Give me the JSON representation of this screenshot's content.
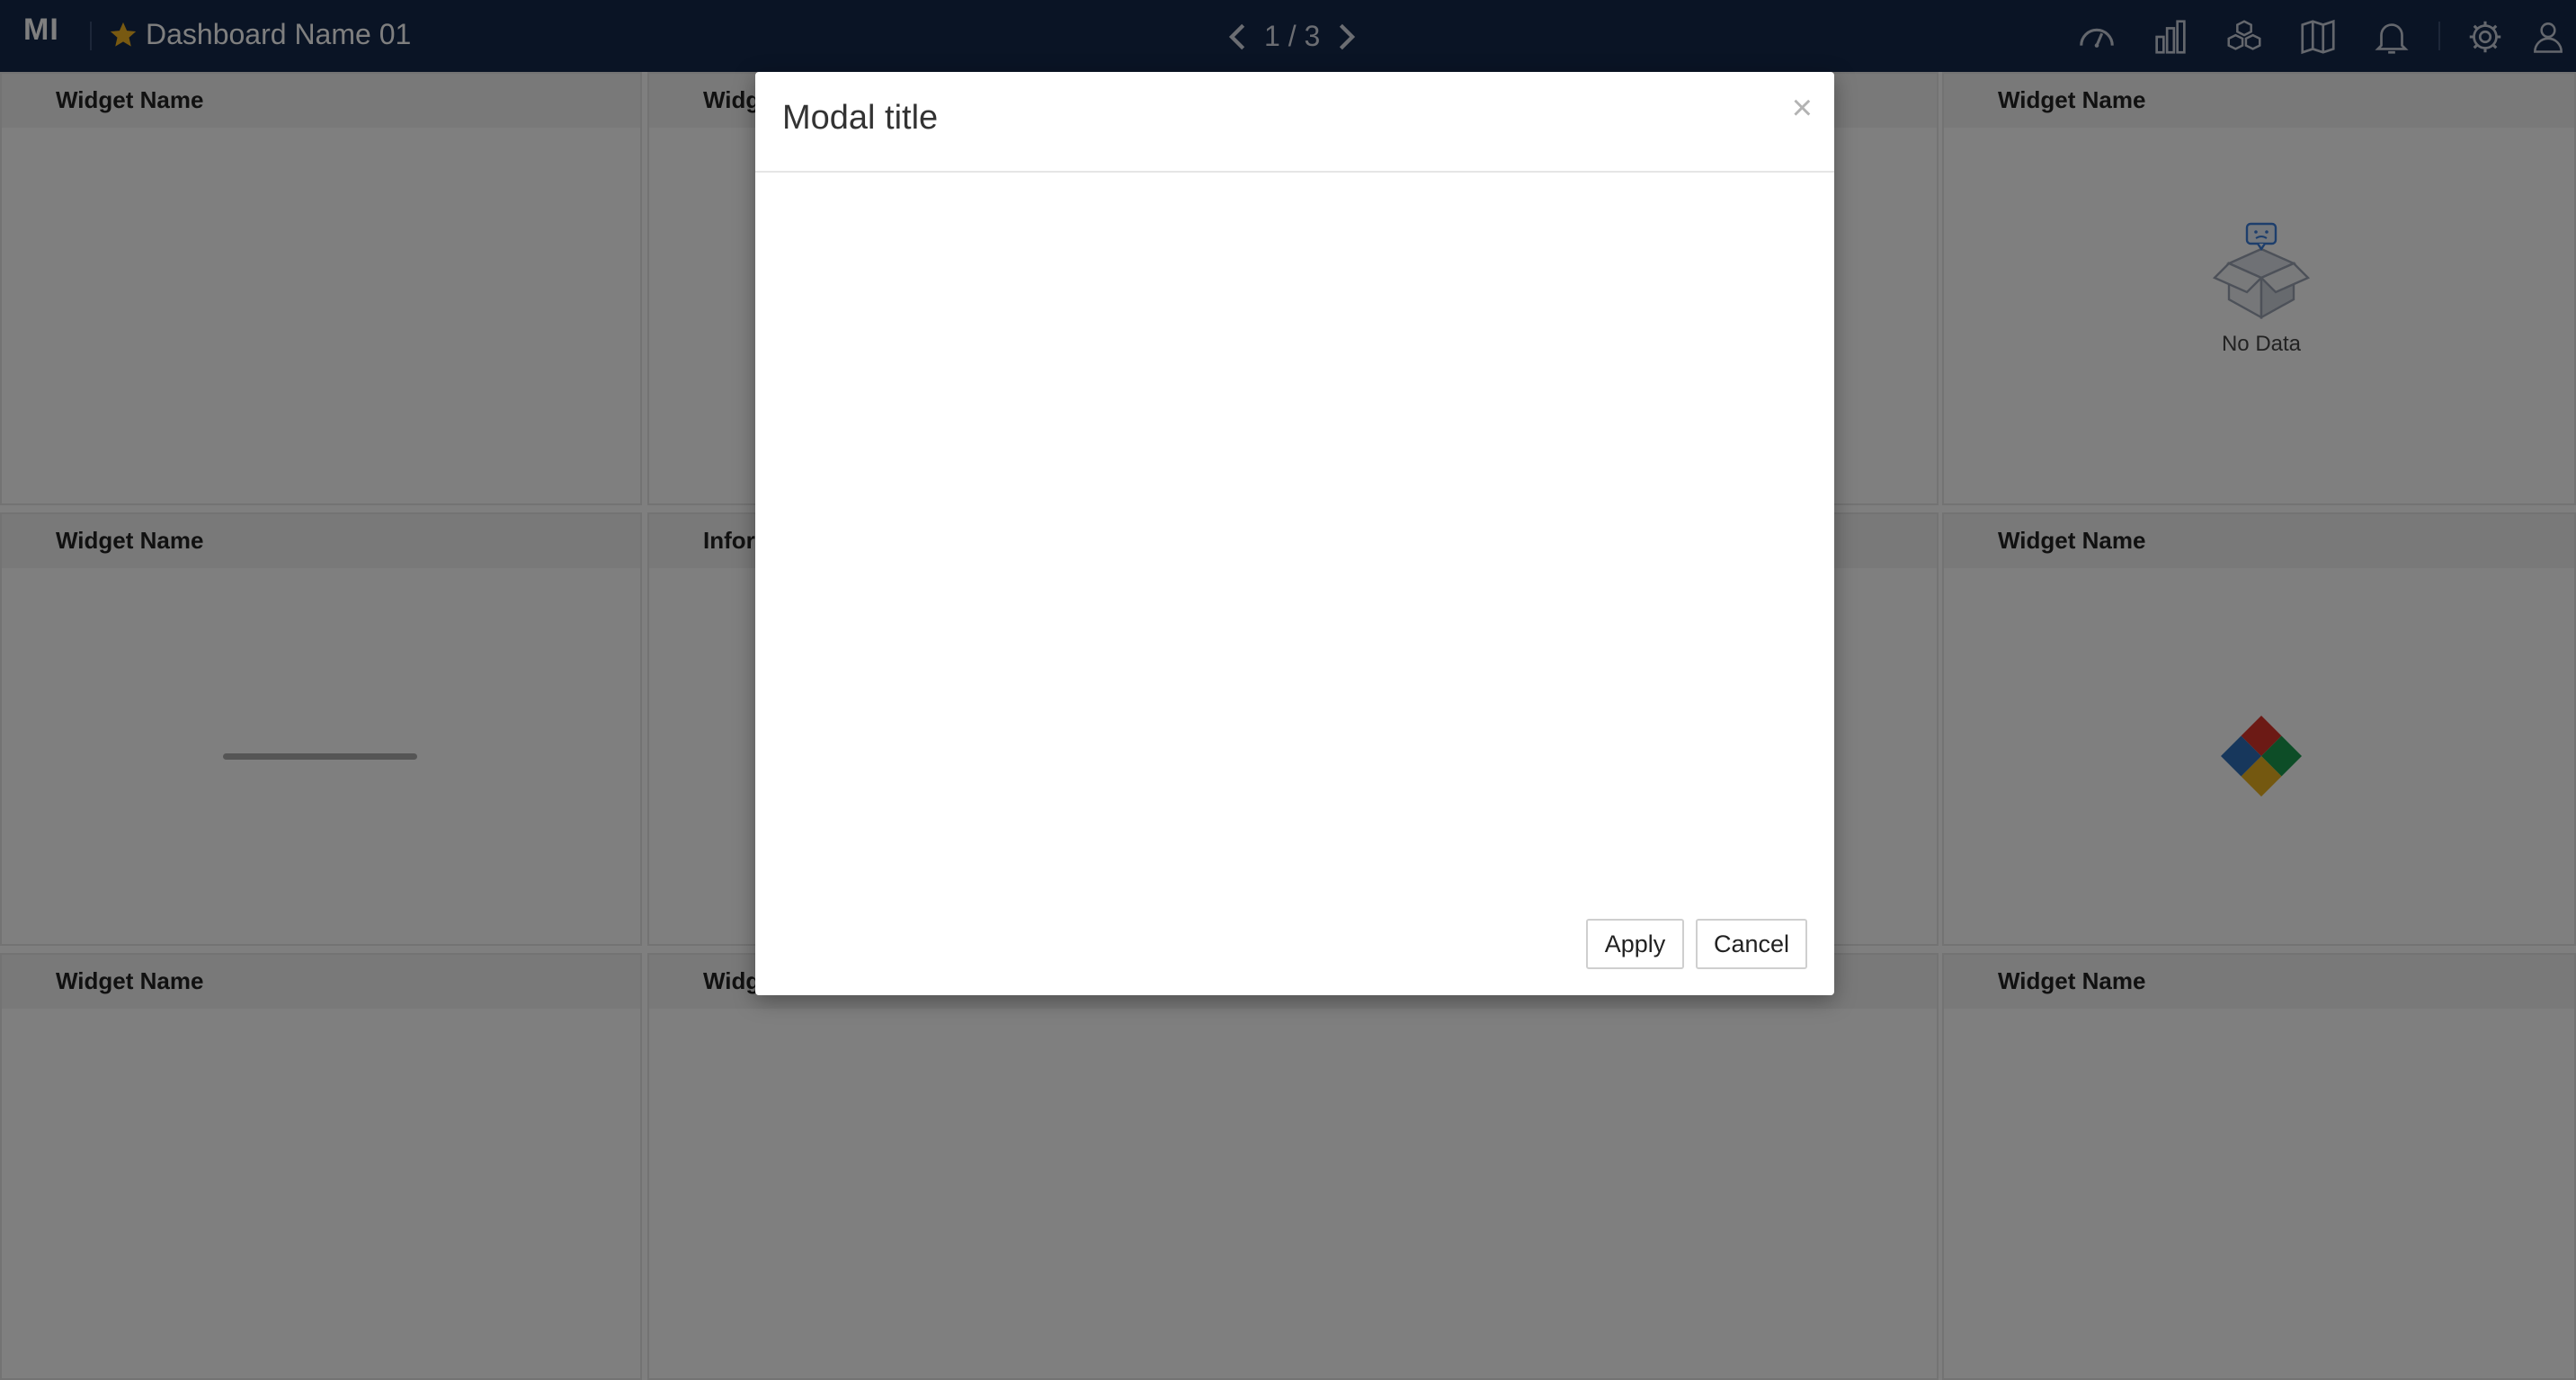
{
  "app": {
    "logo": "MI",
    "dashboard_name": "Dashboard Name 01"
  },
  "pager": {
    "label": "1 / 3"
  },
  "toolbar_icons": [
    "speedometer-icon",
    "bar-chart-icon",
    "cubes-icon",
    "map-icon",
    "bell-icon",
    "gear-icon",
    "user-icon"
  ],
  "widgets": [
    {
      "title": "Widget Name"
    },
    {
      "title": "Widg"
    },
    {
      "title": ""
    },
    {
      "title": "Widget Name"
    },
    {
      "title": "Widget Name"
    },
    {
      "title": "Infor"
    },
    {
      "title": ""
    },
    {
      "title": "Widget Name"
    },
    {
      "title": "Widget Name"
    },
    {
      "title": "Widg"
    },
    {
      "title": ""
    },
    {
      "title": "Widget Name"
    }
  ],
  "nodata": {
    "label": "No Data"
  },
  "modal": {
    "title": "Modal title",
    "close": "×",
    "apply_label": "Apply",
    "cancel_label": "Cancel"
  },
  "colors": {
    "topbar": "#14284b",
    "star": "#f0b323",
    "overlay": "rgba(0,0,0,0.5)"
  }
}
